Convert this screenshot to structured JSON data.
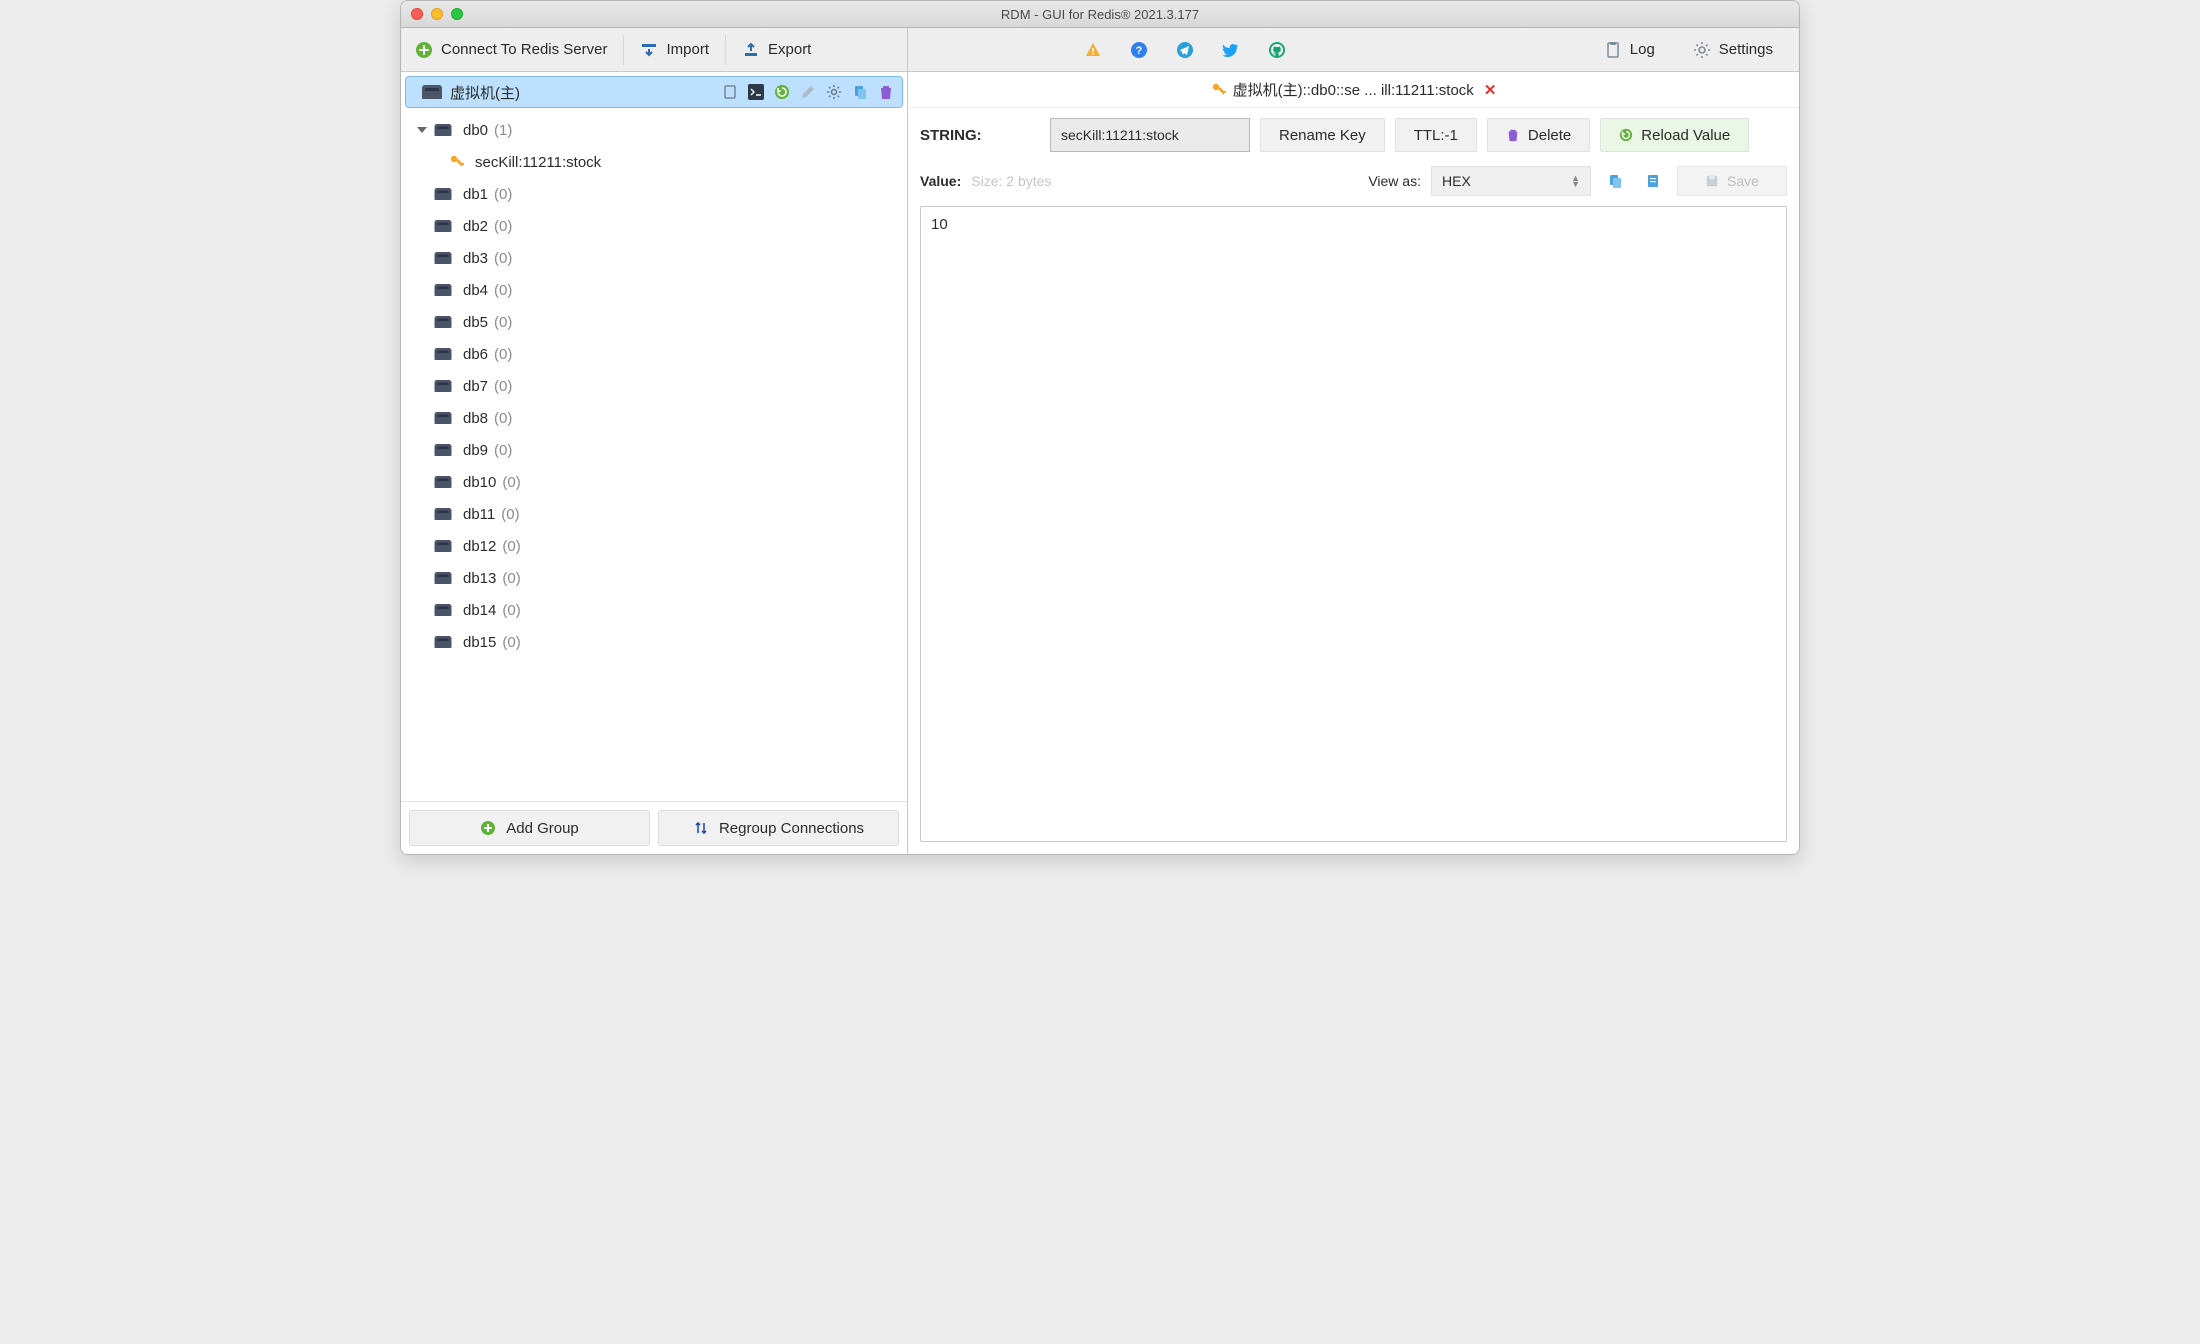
{
  "window": {
    "title": "RDM - GUI for Redis® 2021.3.177"
  },
  "toolbar": {
    "connect": "Connect To Redis Server",
    "import": "Import",
    "export": "Export",
    "log": "Log",
    "settings": "Settings"
  },
  "connection": {
    "name": "虚拟机(主)"
  },
  "databases": [
    {
      "name": "db0",
      "count": "(1)",
      "expanded": true,
      "keys": [
        "secKill:11211:stock"
      ]
    },
    {
      "name": "db1",
      "count": "(0)"
    },
    {
      "name": "db2",
      "count": "(0)"
    },
    {
      "name": "db3",
      "count": "(0)"
    },
    {
      "name": "db4",
      "count": "(0)"
    },
    {
      "name": "db5",
      "count": "(0)"
    },
    {
      "name": "db6",
      "count": "(0)"
    },
    {
      "name": "db7",
      "count": "(0)"
    },
    {
      "name": "db8",
      "count": "(0)"
    },
    {
      "name": "db9",
      "count": "(0)"
    },
    {
      "name": "db10",
      "count": "(0)"
    },
    {
      "name": "db11",
      "count": "(0)"
    },
    {
      "name": "db12",
      "count": "(0)"
    },
    {
      "name": "db13",
      "count": "(0)"
    },
    {
      "name": "db14",
      "count": "(0)"
    },
    {
      "name": "db15",
      "count": "(0)"
    }
  ],
  "footer": {
    "add_group": "Add Group",
    "regroup": "Regroup Connections"
  },
  "tab": {
    "label": "虚拟机(主)::db0::se ... ill:11211:stock"
  },
  "key": {
    "type_label": "STRING:",
    "name": "secKill:11211:stock",
    "rename": "Rename Key",
    "ttl": "TTL:-1",
    "delete": "Delete",
    "reload": "Reload Value"
  },
  "value": {
    "label": "Value:",
    "size": "Size: 2 bytes",
    "view_as_label": "View as:",
    "view_mode": "HEX",
    "save": "Save",
    "content": "10"
  }
}
